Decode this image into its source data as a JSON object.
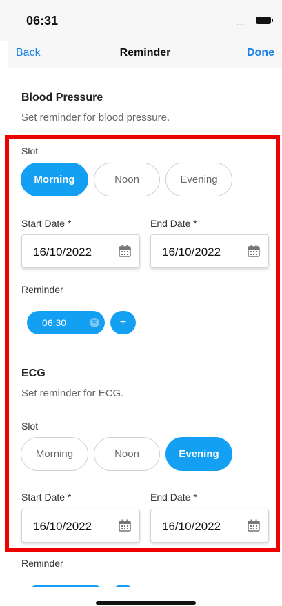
{
  "status_bar": {
    "time": "06:31",
    "signal": "....."
  },
  "nav": {
    "back_label": "Back",
    "title": "Reminder",
    "done_label": "Done"
  },
  "blood_pressure": {
    "title": "Blood Pressure",
    "subtitle": "Set reminder for blood pressure.",
    "slot_label": "Slot",
    "slots": [
      "Morning",
      "Noon",
      "Evening"
    ],
    "selected_slot": "Morning",
    "start_date_label": "Start Date *",
    "start_date_value": "16/10/2022",
    "end_date_label": "End Date *",
    "end_date_value": "16/10/2022",
    "reminder_label": "Reminder",
    "reminder_times": [
      "06:30"
    ],
    "add_label": "+"
  },
  "ecg": {
    "title": "ECG",
    "subtitle": "Set reminder for ECG.",
    "slot_label": "Slot",
    "slots": [
      "Morning",
      "Noon",
      "Evening"
    ],
    "selected_slot": "Evening",
    "start_date_label": "Start Date *",
    "start_date_value": "16/10/2022",
    "end_date_label": "End Date *",
    "end_date_value": "16/10/2022",
    "reminder_label": "Reminder"
  },
  "colors": {
    "accent": "#14a0f2",
    "link": "#1a82e6",
    "highlight": "#ec0000"
  },
  "icons": {
    "date": "calendar-icon",
    "clear": "clear-icon",
    "add": "plus-icon"
  }
}
